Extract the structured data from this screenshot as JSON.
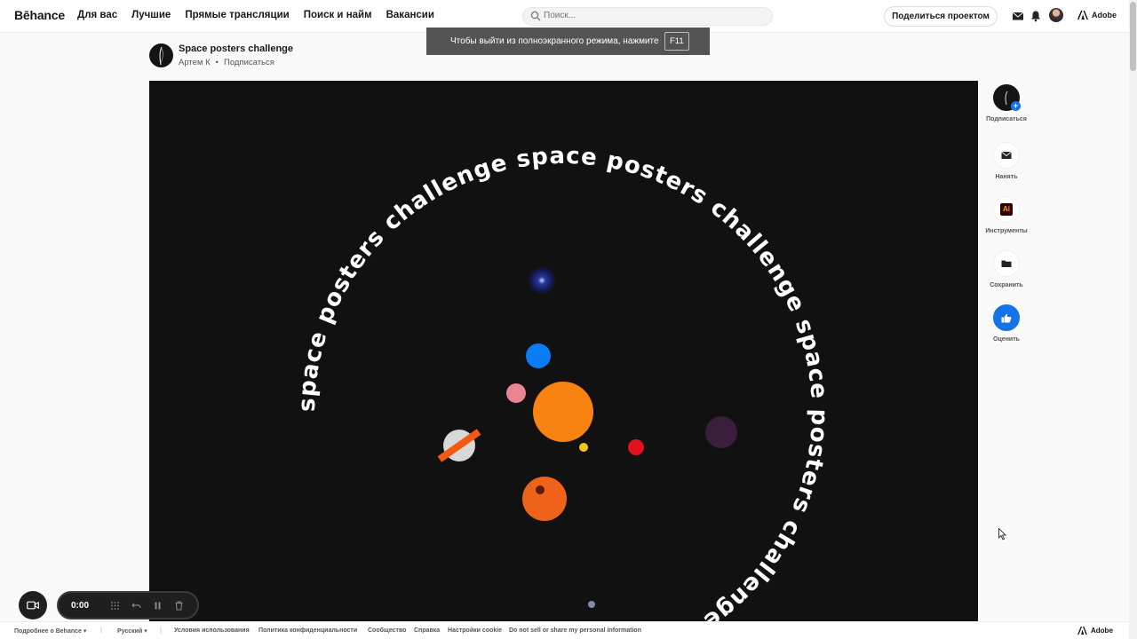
{
  "nav": {
    "logo": "Bēhance",
    "links": [
      "Для вас",
      "Лучшие",
      "Прямые трансляции",
      "Поиск и найм",
      "Вакансии"
    ],
    "search_placeholder": "Поиск...",
    "share_label": "Поделиться проектом",
    "adobe_label": "Adobe"
  },
  "toast": {
    "text": "Чтобы выйти из полноэкранного режима, нажмите",
    "key": "F11"
  },
  "project": {
    "title": "Space posters challenge",
    "author": "Артем К",
    "separator": "•",
    "follow": "Подписаться"
  },
  "poster": {
    "ring_text": "space posters challenge space posters challenge space posters challenge ",
    "colors": {
      "background": "#111111",
      "sun": "#f98310",
      "blue": "#0a7cf5",
      "pink": "#e98490",
      "red": "#e0101d",
      "yellow": "#f4c41c",
      "orange": "#ef6219",
      "purple": "#3a1e3c",
      "navy": "#1a2a7a",
      "grey_planet": "#d8d8d8",
      "ring": "#f25a14",
      "small_grey": "#7d8aa8"
    }
  },
  "rail": {
    "follow": "Подписаться",
    "hire": "Нанять",
    "tools": "Инструменты",
    "save": "Сохранить",
    "rate": "Оценить",
    "tool_badge": "Ai"
  },
  "footer": {
    "about": "Подробнее о Behance ▾",
    "language": "Русский ▾",
    "terms": "Условия использования",
    "privacy": "Политика конфиденциальности",
    "community": "Сообщество",
    "help": "Справка",
    "cookies": "Настройки cookie",
    "dnsell": "Do not sell or share my personal information",
    "adobe": "Adobe"
  },
  "recorder": {
    "time": "0:00"
  },
  "accent": "#1473e6"
}
